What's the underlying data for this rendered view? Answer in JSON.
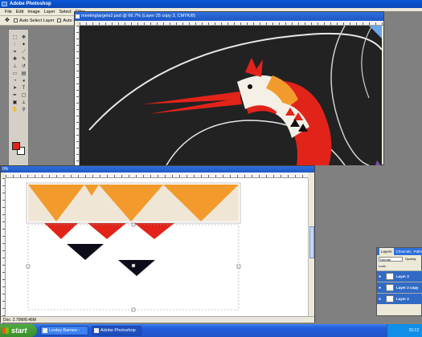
{
  "app": {
    "title": "Adobe Photoshop"
  },
  "menu": [
    "File",
    "Edit",
    "Image",
    "Layer",
    "Select",
    "Filter"
  ],
  "options_bar": {
    "move_tool_icon": "move-icon",
    "auto_select_layer_label": "Auto Select Layer",
    "auto_select_groups_label": "Auto Se"
  },
  "toolbox": {
    "foreground_color": "#e2231a",
    "background_color": "#ffffff"
  },
  "doc_top": {
    "title": "meetingtargets2.psd @ 66.7% (Layer 25 copy 3, CMYK/8)"
  },
  "doc_bottom": {
    "zoom": "0%",
    "status": "Doc: 2.70M/8.46M"
  },
  "layers_panel": {
    "tabs": [
      "Layers",
      "Channels",
      "Paths"
    ],
    "blend_mode": "Normal",
    "opacity_label": "Opacity",
    "lock_label": "Lock:",
    "rows": [
      {
        "name": "Layer 3",
        "selected": true
      },
      {
        "name": "Layer 2 copy",
        "selected": true
      },
      {
        "name": "Layer 2",
        "selected": true
      }
    ]
  },
  "taskbar": {
    "start_label": "start",
    "tasks": [
      "Lesley Barnes - Colou...",
      "Adobe Photoshop"
    ],
    "clock": "15:12"
  },
  "colors": {
    "accent_blue": "#245edb",
    "canvas_dark": "#222222",
    "art_red": "#e2231a",
    "art_orange": "#f39a2c",
    "art_cream": "#efe6d6"
  }
}
